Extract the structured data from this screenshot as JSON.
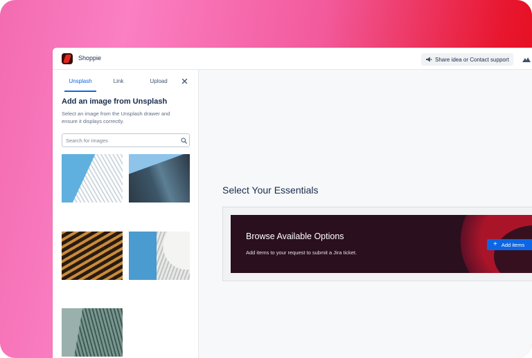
{
  "app": {
    "name": "Shoppie"
  },
  "header": {
    "share_label": "Share idea or Contact support"
  },
  "drawer": {
    "tabs": [
      {
        "label": "Unsplash"
      },
      {
        "label": "Link"
      },
      {
        "label": "Upload"
      }
    ],
    "title": "Add an image from Unsplash",
    "description": "Select an image from the Unsplash drawer and ensure it displays correctly.",
    "search_placeholder": "Search for images"
  },
  "main": {
    "section_title": "Select Your Essentials",
    "banner": {
      "title": "Browse Available Options",
      "subtitle": "Add items to your request to submit a Jira ticket.",
      "button_label": "Add items"
    }
  },
  "colors": {
    "accent": "#0c66e4",
    "banner_bg": "#2a0f1e",
    "frame_pink": "#f36bb0",
    "frame_red": "#e30613"
  }
}
